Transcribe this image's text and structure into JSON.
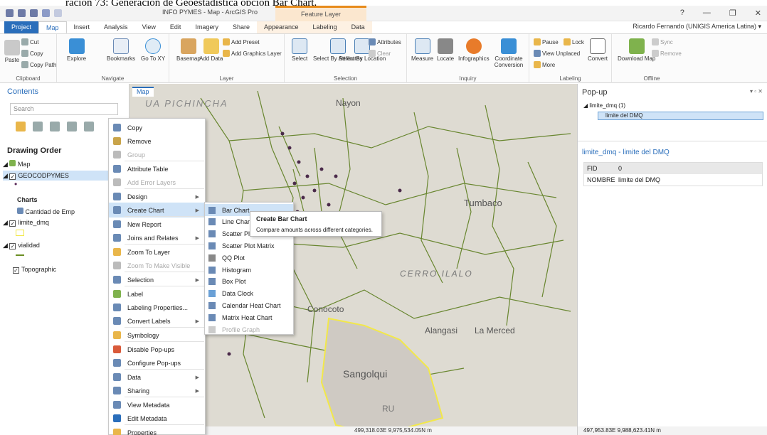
{
  "caption": "ración 73: Generación de Geoestadística opción Bar Chart.",
  "window": {
    "title": "INFO PYMES - Map - ArcGIS Pro",
    "context_tab": "Feature Layer",
    "help": "?",
    "minimize": "—",
    "maximize": "❐",
    "close": "✕"
  },
  "ribbon_tabs": [
    "Project",
    "Map",
    "Insert",
    "Analysis",
    "View",
    "Edit",
    "Imagery",
    "Share",
    "Appearance",
    "Labeling",
    "Data"
  ],
  "user": "Ricardo Fernando (UNIGIS America Latina) ▾",
  "ribbon": {
    "clipboard": {
      "label": "Clipboard",
      "paste": "Paste",
      "cut": "Cut",
      "copy": "Copy",
      "copy_path": "Copy Path"
    },
    "navigate": {
      "label": "Navigate",
      "explore": "Explore",
      "bookmarks": "Bookmarks",
      "goto": "Go To XY"
    },
    "layer": {
      "label": "Layer",
      "basemap": "Basemap",
      "add_data": "Add Data",
      "add_preset": "Add Preset",
      "add_graphics": "Add Graphics Layer"
    },
    "selection": {
      "label": "Selection",
      "select": "Select",
      "by_attr": "Select By Attributes",
      "by_loc": "Select By Location",
      "attributes": "Attributes",
      "clear": "Clear"
    },
    "inquiry": {
      "label": "Inquiry",
      "measure": "Measure",
      "locate": "Locate",
      "infographics": "Infographics",
      "coord": "Coordinate Conversion"
    },
    "labeling": {
      "label": "Labeling",
      "pause": "Pause",
      "lock": "Lock",
      "view_unplaced": "View Unplaced",
      "more": "More",
      "convert": "Convert"
    },
    "offline": {
      "label": "Offline",
      "download": "Download Map",
      "sync": "Sync",
      "remove": "Remove"
    }
  },
  "contents": {
    "title": "Contents",
    "search_placeholder": "Search",
    "drawing_order": "Drawing Order",
    "map": "Map",
    "layer1": "GEOCODPYMES",
    "charts": "Charts",
    "chart1": "Cantidad de Emp",
    "layer2": "limite_dmq",
    "layer3": "vialidad",
    "layer4": "Topographic"
  },
  "map": {
    "tab": "Map",
    "coords": "499,318.03E 9,975,534.05N m",
    "places": [
      "UA PICHINCHA",
      "Nayon",
      "Tumbaco",
      "CERRO ILALO",
      "Conocoto",
      "Alangasi",
      "La Merced",
      "Sangolqui",
      "RU"
    ]
  },
  "context_menu": [
    {
      "label": "Copy"
    },
    {
      "label": "Remove"
    },
    {
      "label": "Group",
      "disabled": true
    },
    {
      "label": "Attribute Table"
    },
    {
      "label": "Add Error Layers",
      "disabled": true
    },
    {
      "label": "Design",
      "sub": true
    },
    {
      "label": "Create Chart",
      "sub": true,
      "hl": true
    },
    {
      "label": "New Report"
    },
    {
      "label": "Joins and Relates",
      "sub": true
    },
    {
      "label": "Zoom To Layer"
    },
    {
      "label": "Zoom To Make Visible",
      "disabled": true
    },
    {
      "label": "Selection",
      "sub": true
    },
    {
      "label": "Label"
    },
    {
      "label": "Labeling Properties..."
    },
    {
      "label": "Convert Labels",
      "sub": true
    },
    {
      "label": "Symbology"
    },
    {
      "label": "Disable Pop-ups"
    },
    {
      "label": "Configure Pop-ups"
    },
    {
      "label": "Data",
      "sub": true
    },
    {
      "label": "Sharing",
      "sub": true
    },
    {
      "label": "View Metadata"
    },
    {
      "label": "Edit Metadata"
    },
    {
      "label": "Properties"
    }
  ],
  "submenu": [
    {
      "label": "Bar Chart",
      "hl": true
    },
    {
      "label": "Line Chart"
    },
    {
      "label": "Scatter Plot"
    },
    {
      "label": "Scatter Plot Matrix"
    },
    {
      "label": "QQ Plot"
    },
    {
      "label": "Histogram"
    },
    {
      "label": "Box Plot"
    },
    {
      "label": "Data Clock"
    },
    {
      "label": "Calendar Heat Chart"
    },
    {
      "label": "Matrix Heat Chart"
    },
    {
      "label": "Profile Graph",
      "disabled": true
    }
  ],
  "tooltip": {
    "title": "Create Bar Chart",
    "text": "Compare amounts across different categories."
  },
  "popup": {
    "title": "Pop-up",
    "tree_layer": "limite_dmq (1)",
    "tree_item": "limite del DMQ",
    "feature_title": "limite_dmq - limite del DMQ",
    "rows": [
      {
        "field": "FID",
        "value": "0"
      },
      {
        "field": "NOMBRE",
        "value": "limite del DMQ"
      }
    ],
    "coords": "497,953.83E 9,988,623.41N m"
  }
}
